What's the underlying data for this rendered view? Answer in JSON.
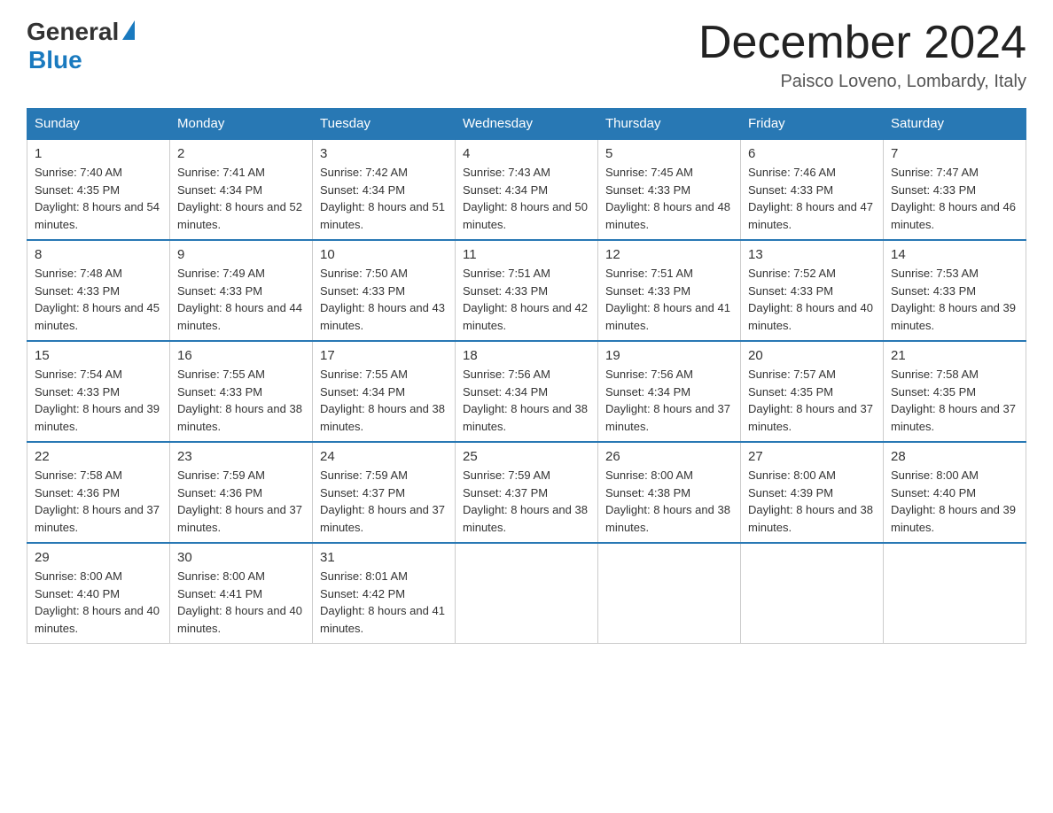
{
  "header": {
    "logo_general": "General",
    "logo_blue": "Blue",
    "month_title": "December 2024",
    "location": "Paisco Loveno, Lombardy, Italy"
  },
  "weekdays": [
    "Sunday",
    "Monday",
    "Tuesday",
    "Wednesday",
    "Thursday",
    "Friday",
    "Saturday"
  ],
  "weeks": [
    [
      {
        "day": "1",
        "sunrise": "Sunrise: 7:40 AM",
        "sunset": "Sunset: 4:35 PM",
        "daylight": "Daylight: 8 hours and 54 minutes."
      },
      {
        "day": "2",
        "sunrise": "Sunrise: 7:41 AM",
        "sunset": "Sunset: 4:34 PM",
        "daylight": "Daylight: 8 hours and 52 minutes."
      },
      {
        "day": "3",
        "sunrise": "Sunrise: 7:42 AM",
        "sunset": "Sunset: 4:34 PM",
        "daylight": "Daylight: 8 hours and 51 minutes."
      },
      {
        "day": "4",
        "sunrise": "Sunrise: 7:43 AM",
        "sunset": "Sunset: 4:34 PM",
        "daylight": "Daylight: 8 hours and 50 minutes."
      },
      {
        "day": "5",
        "sunrise": "Sunrise: 7:45 AM",
        "sunset": "Sunset: 4:33 PM",
        "daylight": "Daylight: 8 hours and 48 minutes."
      },
      {
        "day": "6",
        "sunrise": "Sunrise: 7:46 AM",
        "sunset": "Sunset: 4:33 PM",
        "daylight": "Daylight: 8 hours and 47 minutes."
      },
      {
        "day": "7",
        "sunrise": "Sunrise: 7:47 AM",
        "sunset": "Sunset: 4:33 PM",
        "daylight": "Daylight: 8 hours and 46 minutes."
      }
    ],
    [
      {
        "day": "8",
        "sunrise": "Sunrise: 7:48 AM",
        "sunset": "Sunset: 4:33 PM",
        "daylight": "Daylight: 8 hours and 45 minutes."
      },
      {
        "day": "9",
        "sunrise": "Sunrise: 7:49 AM",
        "sunset": "Sunset: 4:33 PM",
        "daylight": "Daylight: 8 hours and 44 minutes."
      },
      {
        "day": "10",
        "sunrise": "Sunrise: 7:50 AM",
        "sunset": "Sunset: 4:33 PM",
        "daylight": "Daylight: 8 hours and 43 minutes."
      },
      {
        "day": "11",
        "sunrise": "Sunrise: 7:51 AM",
        "sunset": "Sunset: 4:33 PM",
        "daylight": "Daylight: 8 hours and 42 minutes."
      },
      {
        "day": "12",
        "sunrise": "Sunrise: 7:51 AM",
        "sunset": "Sunset: 4:33 PM",
        "daylight": "Daylight: 8 hours and 41 minutes."
      },
      {
        "day": "13",
        "sunrise": "Sunrise: 7:52 AM",
        "sunset": "Sunset: 4:33 PM",
        "daylight": "Daylight: 8 hours and 40 minutes."
      },
      {
        "day": "14",
        "sunrise": "Sunrise: 7:53 AM",
        "sunset": "Sunset: 4:33 PM",
        "daylight": "Daylight: 8 hours and 39 minutes."
      }
    ],
    [
      {
        "day": "15",
        "sunrise": "Sunrise: 7:54 AM",
        "sunset": "Sunset: 4:33 PM",
        "daylight": "Daylight: 8 hours and 39 minutes."
      },
      {
        "day": "16",
        "sunrise": "Sunrise: 7:55 AM",
        "sunset": "Sunset: 4:33 PM",
        "daylight": "Daylight: 8 hours and 38 minutes."
      },
      {
        "day": "17",
        "sunrise": "Sunrise: 7:55 AM",
        "sunset": "Sunset: 4:34 PM",
        "daylight": "Daylight: 8 hours and 38 minutes."
      },
      {
        "day": "18",
        "sunrise": "Sunrise: 7:56 AM",
        "sunset": "Sunset: 4:34 PM",
        "daylight": "Daylight: 8 hours and 38 minutes."
      },
      {
        "day": "19",
        "sunrise": "Sunrise: 7:56 AM",
        "sunset": "Sunset: 4:34 PM",
        "daylight": "Daylight: 8 hours and 37 minutes."
      },
      {
        "day": "20",
        "sunrise": "Sunrise: 7:57 AM",
        "sunset": "Sunset: 4:35 PM",
        "daylight": "Daylight: 8 hours and 37 minutes."
      },
      {
        "day": "21",
        "sunrise": "Sunrise: 7:58 AM",
        "sunset": "Sunset: 4:35 PM",
        "daylight": "Daylight: 8 hours and 37 minutes."
      }
    ],
    [
      {
        "day": "22",
        "sunrise": "Sunrise: 7:58 AM",
        "sunset": "Sunset: 4:36 PM",
        "daylight": "Daylight: 8 hours and 37 minutes."
      },
      {
        "day": "23",
        "sunrise": "Sunrise: 7:59 AM",
        "sunset": "Sunset: 4:36 PM",
        "daylight": "Daylight: 8 hours and 37 minutes."
      },
      {
        "day": "24",
        "sunrise": "Sunrise: 7:59 AM",
        "sunset": "Sunset: 4:37 PM",
        "daylight": "Daylight: 8 hours and 37 minutes."
      },
      {
        "day": "25",
        "sunrise": "Sunrise: 7:59 AM",
        "sunset": "Sunset: 4:37 PM",
        "daylight": "Daylight: 8 hours and 38 minutes."
      },
      {
        "day": "26",
        "sunrise": "Sunrise: 8:00 AM",
        "sunset": "Sunset: 4:38 PM",
        "daylight": "Daylight: 8 hours and 38 minutes."
      },
      {
        "day": "27",
        "sunrise": "Sunrise: 8:00 AM",
        "sunset": "Sunset: 4:39 PM",
        "daylight": "Daylight: 8 hours and 38 minutes."
      },
      {
        "day": "28",
        "sunrise": "Sunrise: 8:00 AM",
        "sunset": "Sunset: 4:40 PM",
        "daylight": "Daylight: 8 hours and 39 minutes."
      }
    ],
    [
      {
        "day": "29",
        "sunrise": "Sunrise: 8:00 AM",
        "sunset": "Sunset: 4:40 PM",
        "daylight": "Daylight: 8 hours and 40 minutes."
      },
      {
        "day": "30",
        "sunrise": "Sunrise: 8:00 AM",
        "sunset": "Sunset: 4:41 PM",
        "daylight": "Daylight: 8 hours and 40 minutes."
      },
      {
        "day": "31",
        "sunrise": "Sunrise: 8:01 AM",
        "sunset": "Sunset: 4:42 PM",
        "daylight": "Daylight: 8 hours and 41 minutes."
      },
      null,
      null,
      null,
      null
    ]
  ]
}
